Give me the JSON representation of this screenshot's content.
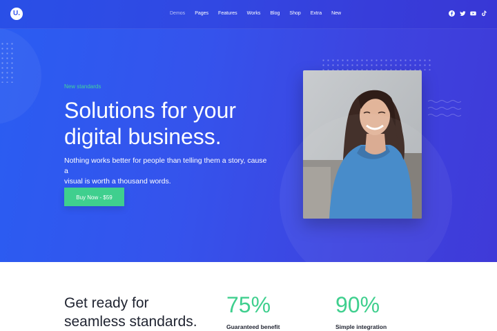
{
  "brand": {
    "logo_letter": "U."
  },
  "nav": {
    "items": [
      {
        "label": "Demos",
        "active": true
      },
      {
        "label": "Pages"
      },
      {
        "label": "Features"
      },
      {
        "label": "Works"
      },
      {
        "label": "Blog"
      },
      {
        "label": "Shop"
      },
      {
        "label": "Extra"
      },
      {
        "label": "New"
      }
    ],
    "social_icons": [
      "facebook-icon",
      "twitter-icon",
      "youtube-icon",
      "tiktok-icon"
    ]
  },
  "hero": {
    "tag": "New standards",
    "headline_line1": "Solutions for your",
    "headline_line2": "digital business.",
    "description_line1": "Nothing works better for people than telling them a story, cause a",
    "description_line2": "visual is worth a thousand words.",
    "cta_label": "Buy Now - $59",
    "image_alt": "smiling woman in blue sweater"
  },
  "features": {
    "heading_line1": "Get ready for",
    "heading_line2": "seamless standards.",
    "stats": [
      {
        "value": "75%",
        "label": "Guaranteed benefit"
      },
      {
        "value": "90%",
        "label": "Simple integration"
      }
    ]
  },
  "colors": {
    "hero_gradient_start": "#2a5df2",
    "hero_gradient_end": "#3f3ad8",
    "accent_green": "#3fcf8e",
    "text_dark": "#1f2330"
  }
}
